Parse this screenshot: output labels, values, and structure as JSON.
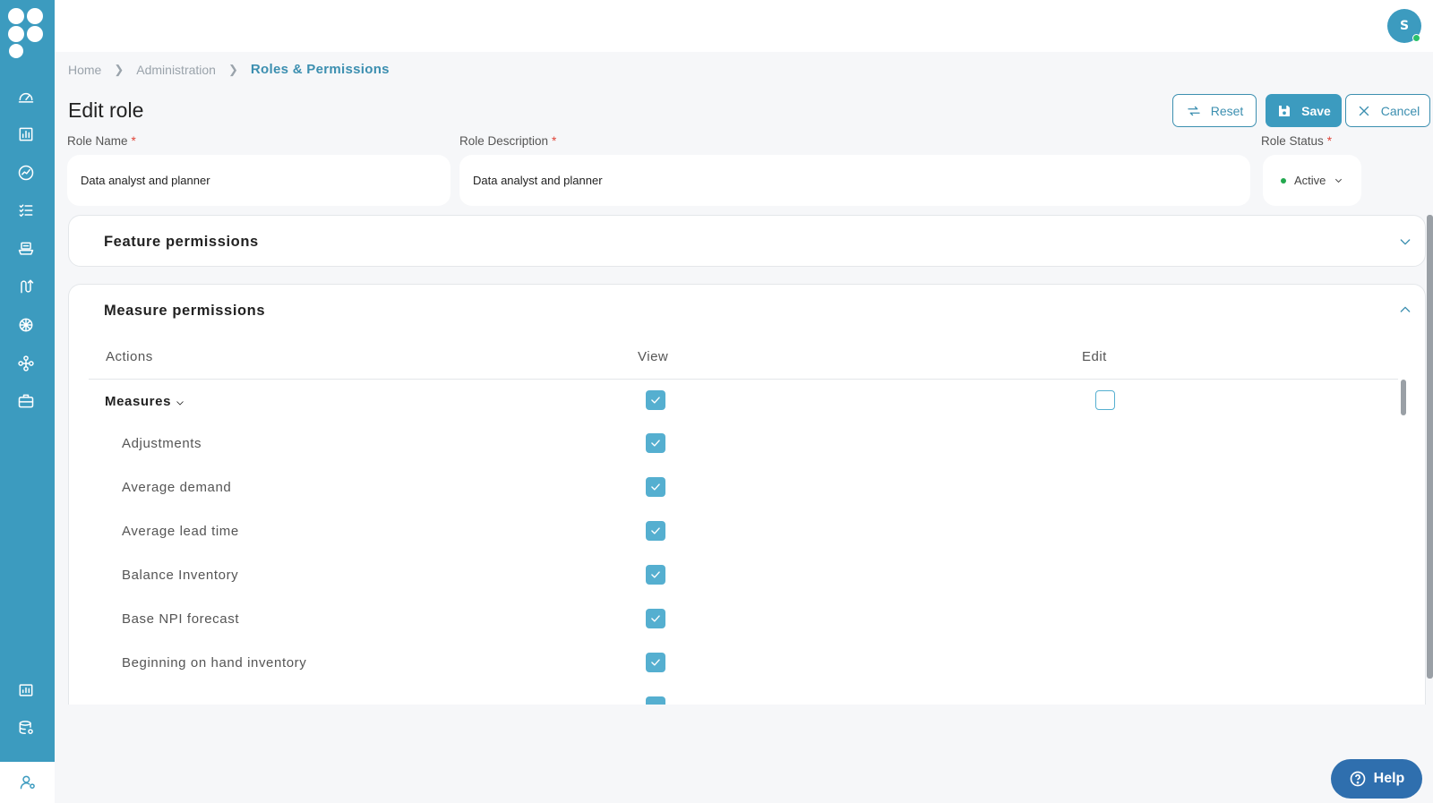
{
  "user": {
    "initial": "S"
  },
  "breadcrumb": {
    "home": "Home",
    "admin": "Administration",
    "current": "Roles & Permissions"
  },
  "page": {
    "title": "Edit role"
  },
  "toolbar": {
    "reset_label": "Reset",
    "save_label": "Save",
    "cancel_label": "Cancel"
  },
  "form": {
    "role_name_label": "Role Name",
    "role_name_value": "Data analyst and planner",
    "role_desc_label": "Role Description",
    "role_desc_value": "Data analyst and planner",
    "role_status_label": "Role Status",
    "role_status_value": "Active",
    "required_mark": "*"
  },
  "panels": {
    "feature_title": "Feature permissions",
    "measure_title": "Measure permissions"
  },
  "table": {
    "col_actions": "Actions",
    "col_view": "View",
    "col_edit": "Edit",
    "parent": {
      "label": "Measures",
      "view": true,
      "edit": false
    },
    "rows": [
      {
        "label": "Adjustments",
        "view": true
      },
      {
        "label": "Average demand",
        "view": true
      },
      {
        "label": "Average lead time",
        "view": true
      },
      {
        "label": "Balance Inventory",
        "view": true
      },
      {
        "label": "Base NPI forecast",
        "view": true
      },
      {
        "label": "Beginning on hand inventory",
        "view": true
      }
    ]
  },
  "help": {
    "label": "Help"
  },
  "colors": {
    "brand": "#3c9bbf",
    "accent_text": "#3c8fb0",
    "checkbox": "#55afd0",
    "required": "#e0453a",
    "help": "#2f6fae",
    "status_active": "#22a84e"
  }
}
